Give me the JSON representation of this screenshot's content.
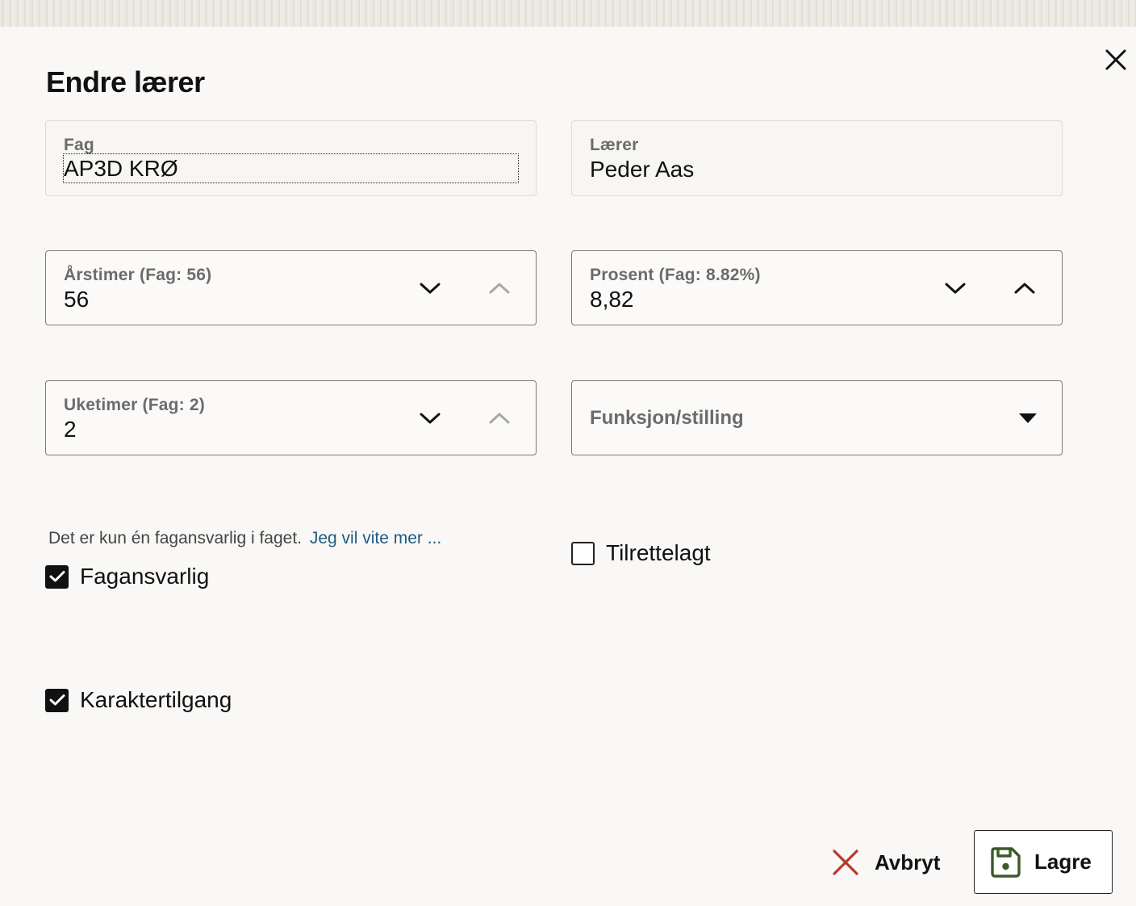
{
  "dialog": {
    "title": "Endre lærer",
    "close_icon": "close-icon"
  },
  "fields": {
    "fag": {
      "label": "Fag",
      "value": "AP3D KRØ"
    },
    "laerer": {
      "label": "Lærer",
      "value": "Peder Aas"
    },
    "arstimer": {
      "label": "Årstimer (Fag: 56)",
      "value": "56"
    },
    "prosent": {
      "label": "Prosent (Fag: 8.82%)",
      "value": "8,82"
    },
    "uketimer": {
      "label": "Uketimer (Fag: 2)",
      "value": "2"
    },
    "funksjon": {
      "label": "Funksjon/stilling",
      "value": ""
    }
  },
  "info": {
    "text": "Det er kun én fagansvarlig i faget.",
    "link": "Jeg vil vite mer ..."
  },
  "checkboxes": {
    "fagansvarlig": {
      "label": "Fagansvarlig",
      "checked": true
    },
    "tilrettelagt": {
      "label": "Tilrettelagt",
      "checked": false
    },
    "karaktertilgang": {
      "label": "Karaktertilgang",
      "checked": true
    }
  },
  "actions": {
    "cancel_label": "Avbryt",
    "save_label": "Lagre"
  },
  "colors": {
    "cancel_icon": "#b23a2b",
    "save_icon": "#3d5a2a",
    "link": "#1e5a82"
  }
}
